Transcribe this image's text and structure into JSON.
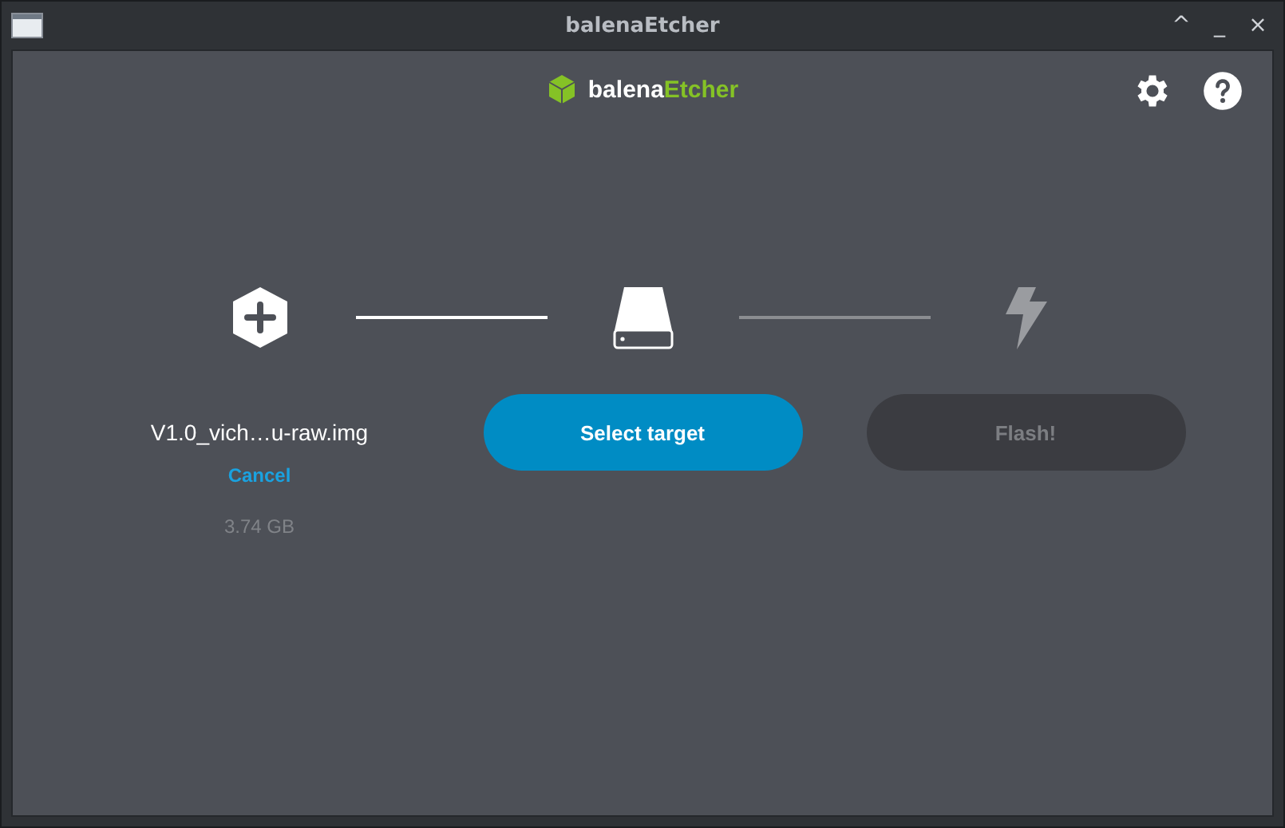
{
  "window": {
    "title": "balenaEtcher",
    "controls": [
      "^",
      "_",
      "×"
    ]
  },
  "header": {
    "logo": {
      "prefix": "balena",
      "suffix": "Etcher"
    }
  },
  "steps": [
    {
      "kind": "image",
      "enabled": true,
      "file_name": "V1.0_vich…u-raw.img",
      "action": "Cancel",
      "size": "3.74 GB"
    },
    {
      "kind": "drive",
      "enabled": true,
      "button": "Select target",
      "connector_done": true
    },
    {
      "kind": "flash",
      "enabled": false,
      "button": "Flash!",
      "connector_done": false
    }
  ]
}
